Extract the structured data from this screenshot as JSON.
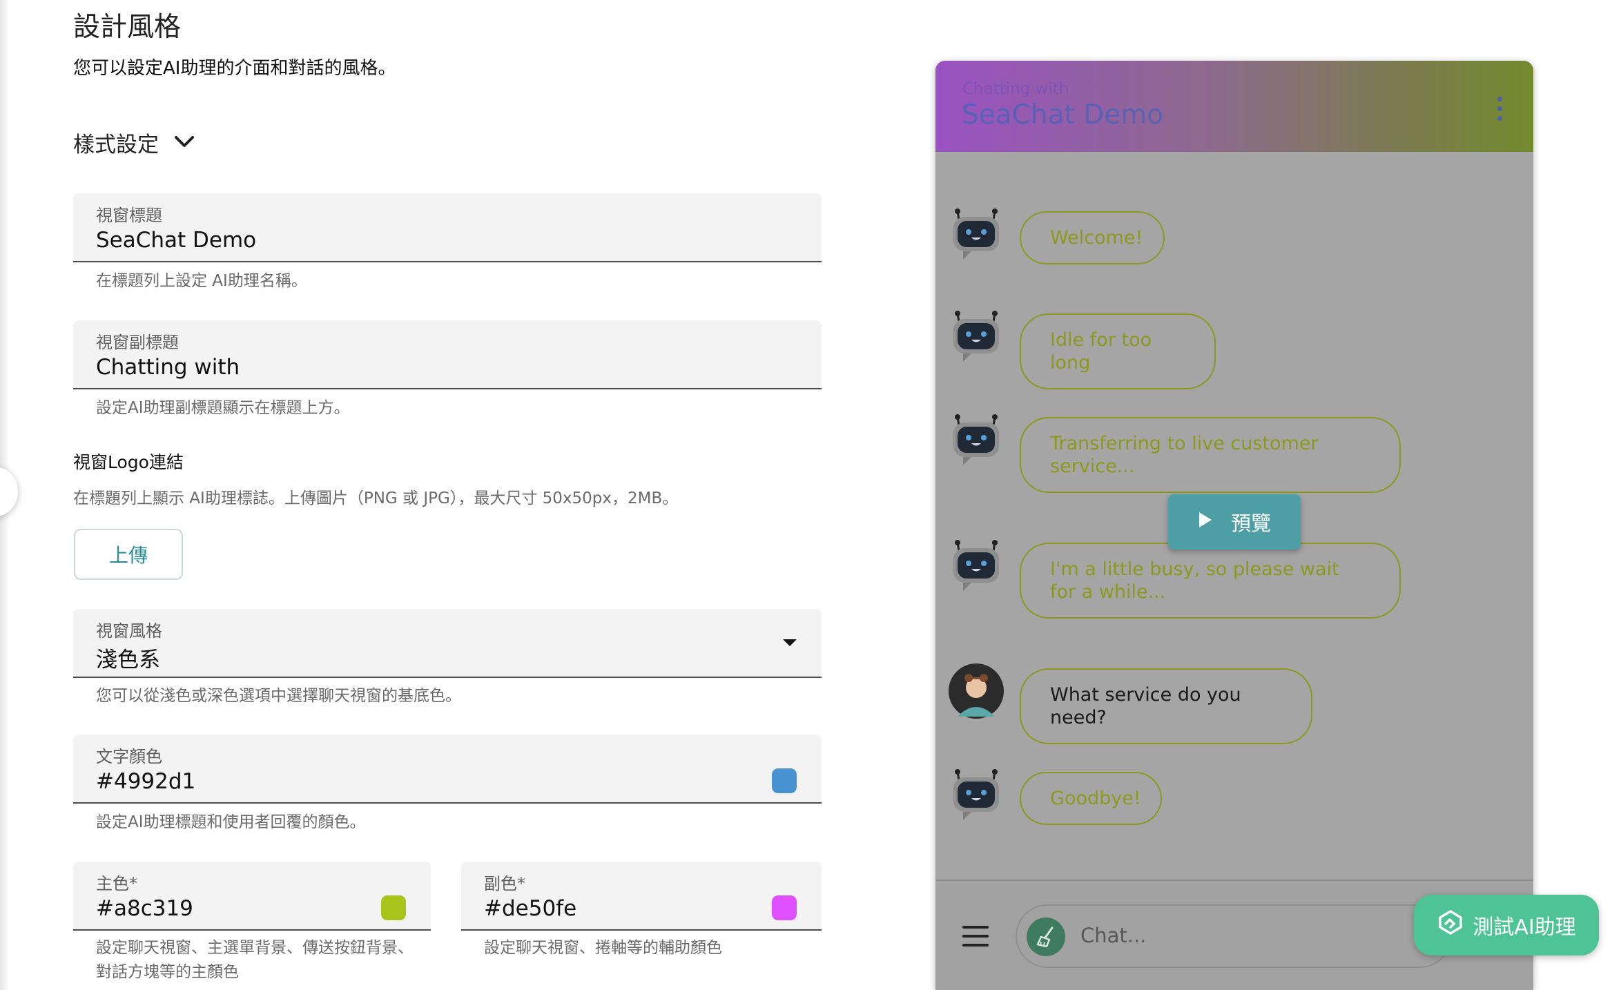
{
  "page": {
    "title": "設計風格",
    "description": "您可以設定AI助理的介面和對話的風格。"
  },
  "section": {
    "label": "樣式設定",
    "icon": "chevron-down-icon"
  },
  "fields": {
    "window_title": {
      "label": "視窗標題",
      "value": "SeaChat Demo",
      "hint": "在標題列上設定 AI助理名稱。"
    },
    "window_subtitle": {
      "label": "視窗副標題",
      "value": "Chatting with",
      "hint": "設定AI助理副標題顯示在標題上方。"
    },
    "logo": {
      "label": "視窗Logo連結",
      "hint": "在標題列上顯示 AI助理標誌。上傳圖片（PNG 或 JPG），最大尺寸 50x50px，2MB。",
      "upload_label": "上傳"
    },
    "window_style": {
      "label": "視窗風格",
      "value": "淺色系",
      "hint": "您可以從淺色或深色選項中選擇聊天視窗的基底色。"
    },
    "text_color": {
      "label": "文字顏色",
      "value": "#4992d1",
      "hint": "設定AI助理標題和使用者回覆的顏色。",
      "swatch": "#4992d1"
    },
    "primary_color": {
      "label": "主色*",
      "value": "#a8c319",
      "hint": "設定聊天視窗、主選單背景、傳送按鈕背景、對話方塊等的主顏色",
      "swatch": "#a8c319"
    },
    "secondary_color": {
      "label": "副色*",
      "value": "#de50fe",
      "hint": "設定聊天視窗、捲軸等的輔助顏色",
      "swatch": "#de50fe"
    }
  },
  "preview": {
    "subtitle": "Chatting with",
    "title": "SeaChat Demo",
    "menu_icon": "kebab-menu-icon",
    "messages": [
      {
        "sender": "bot",
        "text": "Welcome!"
      },
      {
        "sender": "bot",
        "text": "Idle for too long"
      },
      {
        "sender": "bot",
        "text": "Transferring to live customer service..."
      },
      {
        "sender": "bot",
        "text": "I'm a little busy, so please wait for a while..."
      },
      {
        "sender": "user",
        "text": "What service do you need?"
      },
      {
        "sender": "bot",
        "text": "Goodbye!"
      }
    ],
    "preview_button": "預覽",
    "input_placeholder": "Chat...",
    "menu_button_icon": "hamburger-icon",
    "clear_icon": "broom-icon"
  },
  "test_button": "測試AI助理",
  "colors": {
    "accent": "#2b8c96",
    "preview_button": "#4e9ea5",
    "test_button": "#4ec395",
    "bubble_border": "#8a9a1e"
  }
}
